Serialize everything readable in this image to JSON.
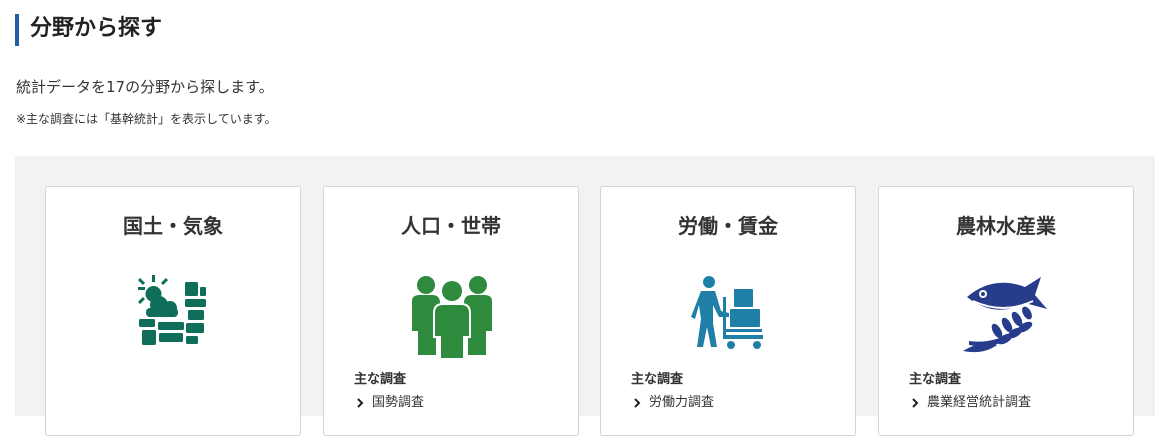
{
  "header": {
    "title": "分野から探す",
    "lead": "統計データを17の分野から探します。",
    "note": "※主な調査には「基幹統計」を表示しています。"
  },
  "colors": {
    "accent_bar": "#1f5fa8",
    "land_icon": "#0e6e5a",
    "population_icon": "#2e8b3e",
    "labor_icon": "#1f7fa6",
    "agriculture_icon": "#283c8c"
  },
  "cards": [
    {
      "title": "国土・気象",
      "icon": "weather-land-icon",
      "survey_heading": "",
      "survey_link": ""
    },
    {
      "title": "人口・世帯",
      "icon": "people-group-icon",
      "survey_heading": "主な調査",
      "survey_link": "国勢調査"
    },
    {
      "title": "労働・賃金",
      "icon": "worker-cart-icon",
      "survey_heading": "主な調査",
      "survey_link": "労働力調査"
    },
    {
      "title": "農林水産業",
      "icon": "fish-wheat-icon",
      "survey_heading": "主な調査",
      "survey_link": "農業経営統計調査"
    }
  ]
}
